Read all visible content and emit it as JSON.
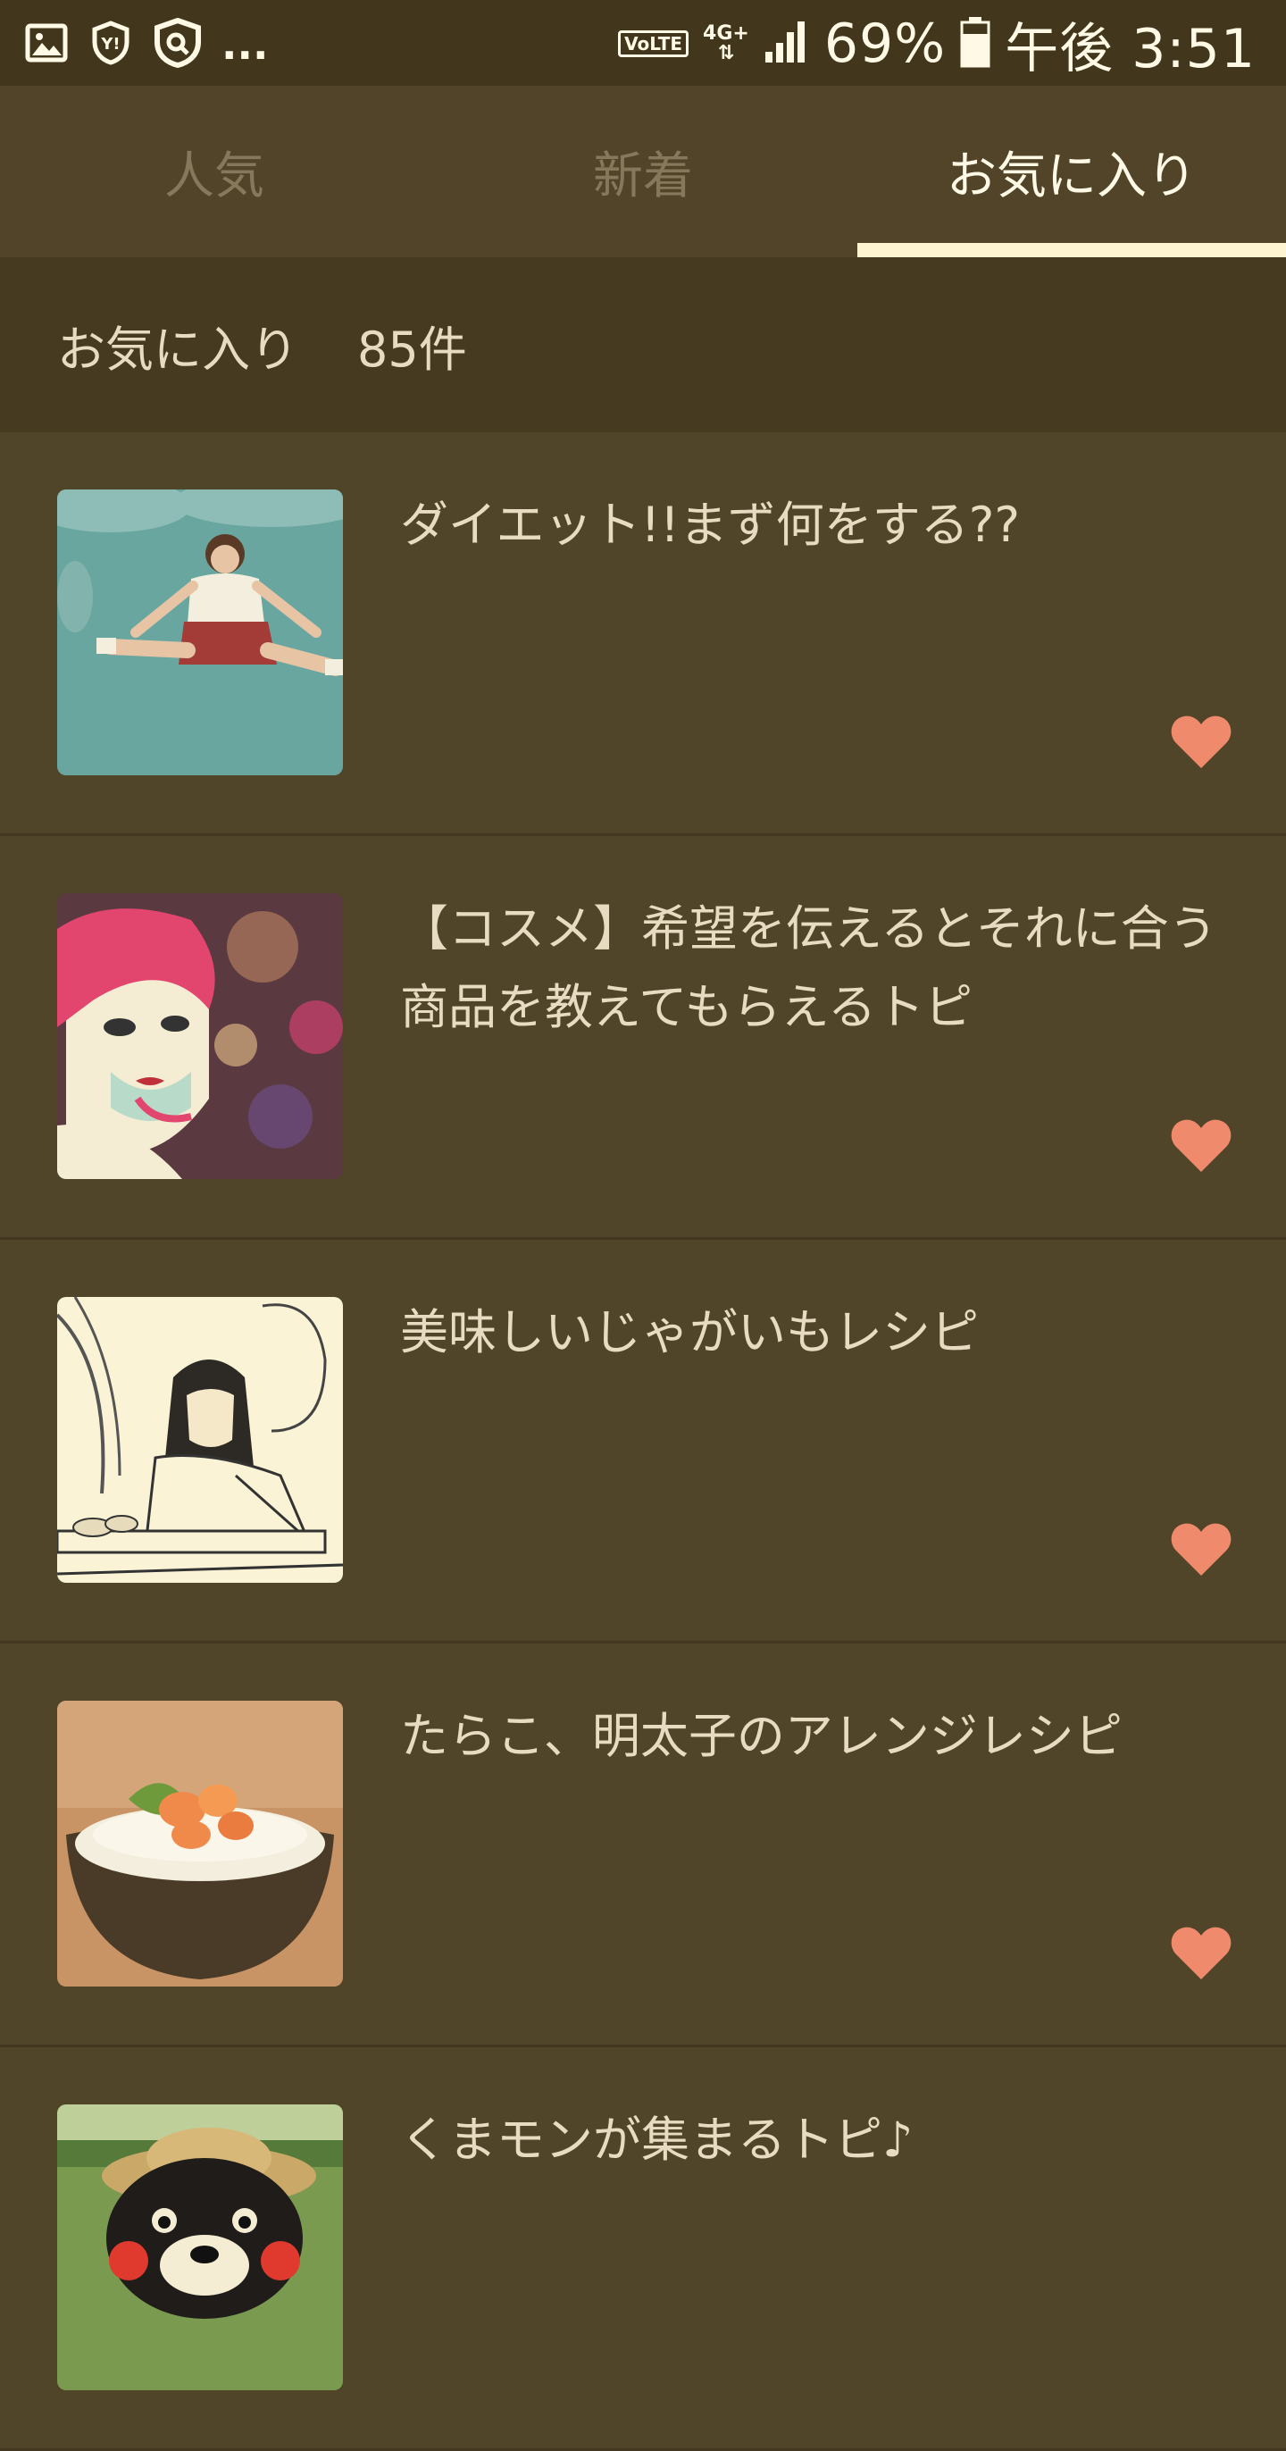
{
  "status_bar": {
    "icons_left": [
      "image-icon",
      "yahoo-shield-icon",
      "security-shield-icon"
    ],
    "more": "...",
    "volte": "VoLTE",
    "network": "4G+",
    "battery": "69%",
    "time": "午後 3:51"
  },
  "tabs": [
    {
      "label": "人気",
      "active": false
    },
    {
      "label": "新着",
      "active": false
    },
    {
      "label": "お気に入り",
      "active": true
    }
  ],
  "favorites_header": {
    "label": "お気に入り",
    "count": "85件"
  },
  "items": [
    {
      "title": "ダイエット!!まず何をする??",
      "favorited": true
    },
    {
      "title": "【コスメ】希望を伝えるとそれに合う商品を教えてもらえるトピ",
      "favorited": true
    },
    {
      "title": "美味しいじゃがいもレシピ",
      "favorited": true
    },
    {
      "title": "たらこ、明太子のアレンジレシピ",
      "favorited": true
    },
    {
      "title": "くまモンが集まるトピ♪",
      "favorited": true
    }
  ],
  "colors": {
    "background": "#504429",
    "active_tab": "#fff9e6",
    "inactive_tab": "#86795b",
    "heart": "#f08a6c"
  }
}
